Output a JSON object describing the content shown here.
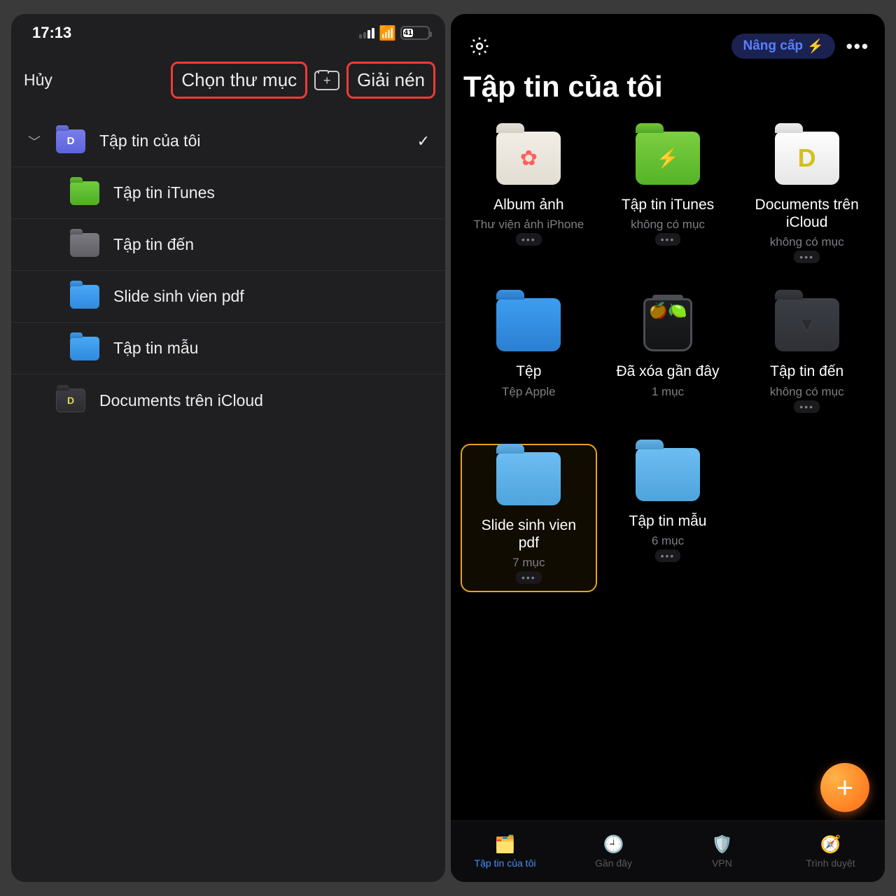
{
  "left": {
    "time": "17:13",
    "battery_pct": "41",
    "cancel": "Hủy",
    "choose_folder": "Chọn thư mục",
    "extract": "Giải nén",
    "root_item": "Tập tin của tôi",
    "items": [
      {
        "label": "Tập tin iTunes"
      },
      {
        "label": "Tập tin đến"
      },
      {
        "label": "Slide sinh vien pdf"
      },
      {
        "label": "Tập tin mẫu"
      }
    ],
    "icloud_item": "Documents trên iCloud"
  },
  "right": {
    "upgrade": "Nâng cấp",
    "title": "Tập tin của tôi",
    "tiles": [
      {
        "name": "Album ảnh",
        "sub": "Thư viện ảnh iPhone"
      },
      {
        "name": "Tập tin iTunes",
        "sub": "không có mục"
      },
      {
        "name": "Documents trên iCloud",
        "sub": "không có mục"
      },
      {
        "name": "Tệp",
        "sub": "Tệp Apple"
      },
      {
        "name": "Đã xóa gần đây",
        "sub": "1 mục"
      },
      {
        "name": "Tập tin đến",
        "sub": "không có mục"
      },
      {
        "name": "Slide sinh vien pdf",
        "sub": "7 mục"
      },
      {
        "name": "Tập tin mẫu",
        "sub": "6 mục"
      }
    ],
    "tabs": {
      "files": "Tập tin của tôi",
      "recent": "Gần đây",
      "vpn": "VPN",
      "browser": "Trình duyệt"
    }
  }
}
